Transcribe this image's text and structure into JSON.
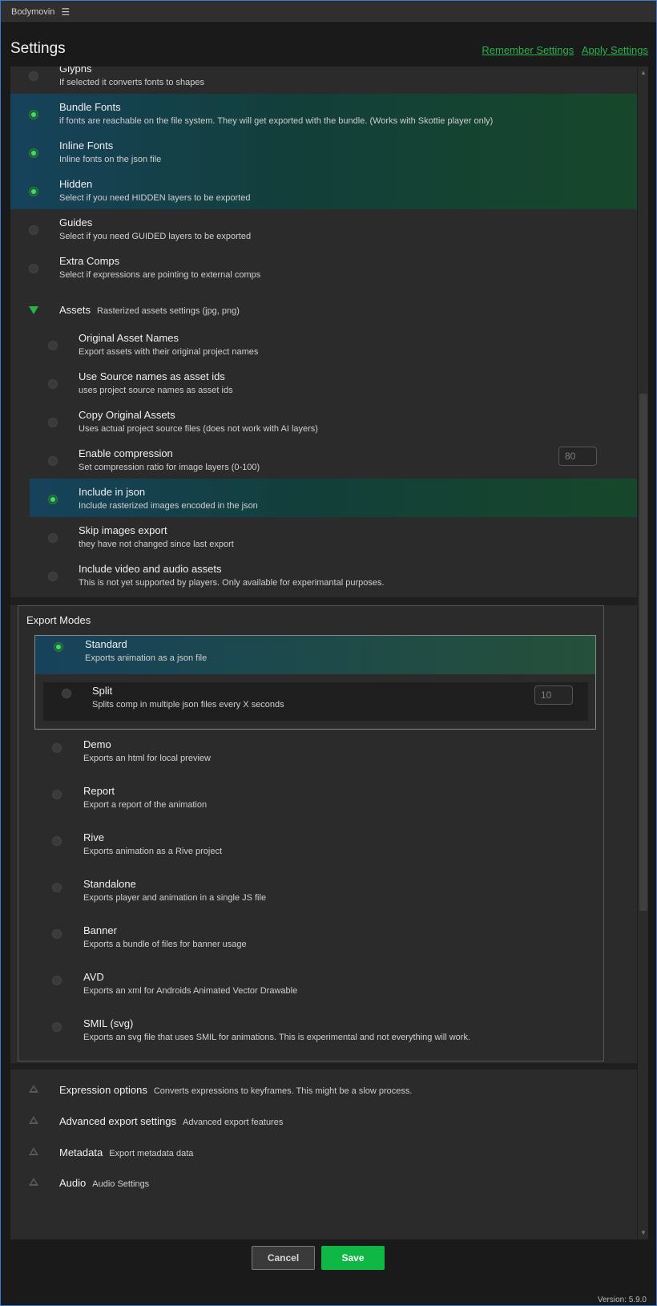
{
  "window": {
    "title": "Bodymovin",
    "menu_icon": "hamburger-menu-icon"
  },
  "header": {
    "title": "Settings",
    "remember_settings": "Remember Settings",
    "apply_settings": "Apply Settings"
  },
  "options": [
    {
      "label": "Glyphs",
      "desc": "If selected it converts fonts to shapes",
      "selected": false
    },
    {
      "label": "Bundle Fonts",
      "desc": "if fonts are reachable on the file system. They will get exported with the bundle. (Works with Skottie player only)",
      "selected": true
    },
    {
      "label": "Inline Fonts",
      "desc": "Inline fonts on the json file",
      "selected": true
    },
    {
      "label": "Hidden",
      "desc": "Select if you need HIDDEN layers to be exported",
      "selected": true
    },
    {
      "label": "Guides",
      "desc": "Select if you need GUIDED layers to be exported",
      "selected": false
    },
    {
      "label": "Extra Comps",
      "desc": "Select if expressions are pointing to external comps",
      "selected": false
    }
  ],
  "assets": {
    "label": "Assets",
    "desc": "Rasterized assets settings (jpg, png)",
    "expanded": true,
    "items": [
      {
        "label": "Original Asset Names",
        "desc": "Export assets with their original project names",
        "selected": false
      },
      {
        "label": "Use Source names as asset ids",
        "desc": "uses project source names as asset ids",
        "selected": false
      },
      {
        "label": "Copy Original Assets",
        "desc": "Uses actual project source files (does not work with AI layers)",
        "selected": false
      },
      {
        "label": "Enable compression",
        "desc": "Set compression ratio for image layers (0-100)",
        "selected": false,
        "value": "80"
      },
      {
        "label": "Include in json",
        "desc": "Include rasterized images encoded in the json",
        "selected": true
      },
      {
        "label": "Skip images export",
        "desc": "they have not changed since last export",
        "selected": false
      },
      {
        "label": "Include video and audio assets",
        "desc": "This is not yet supported by players. Only available for experimantal purposes.",
        "selected": false
      }
    ]
  },
  "export_modes": {
    "title": "Export Modes",
    "standard": {
      "label": "Standard",
      "desc": "Exports animation as a json file",
      "selected": true
    },
    "split": {
      "label": "Split",
      "desc": "Splits comp in multiple json files every X seconds",
      "selected": false,
      "value": "10"
    },
    "modes": [
      {
        "label": "Demo",
        "desc": "Exports an html for local preview"
      },
      {
        "label": "Report",
        "desc": "Export a report of the animation"
      },
      {
        "label": "Rive",
        "desc": "Exports animation as a Rive project"
      },
      {
        "label": "Standalone",
        "desc": "Exports player and animation in a single JS file"
      },
      {
        "label": "Banner",
        "desc": "Exports a bundle of files for banner usage"
      },
      {
        "label": "AVD",
        "desc": "Exports an xml for Androids Animated Vector Drawable"
      },
      {
        "label": "SMIL (svg)",
        "desc": "Exports an svg file that uses SMIL for animations. This is experimental and not everything will work."
      }
    ]
  },
  "sections": [
    {
      "label": "Expression options",
      "desc": "Converts expressions to keyframes. This might be a slow process."
    },
    {
      "label": "Advanced export settings",
      "desc": "Advanced export features"
    },
    {
      "label": "Metadata",
      "desc": "Export metadata data"
    },
    {
      "label": "Audio",
      "desc": "Audio Settings"
    }
  ],
  "footer": {
    "cancel": "Cancel",
    "save": "Save",
    "version": "Version: 5.9.0"
  },
  "colors": {
    "accent": "#27b34b",
    "save": "#0fb845",
    "selected_gradient_start": "#17425c",
    "selected_gradient_end": "#17472a"
  }
}
